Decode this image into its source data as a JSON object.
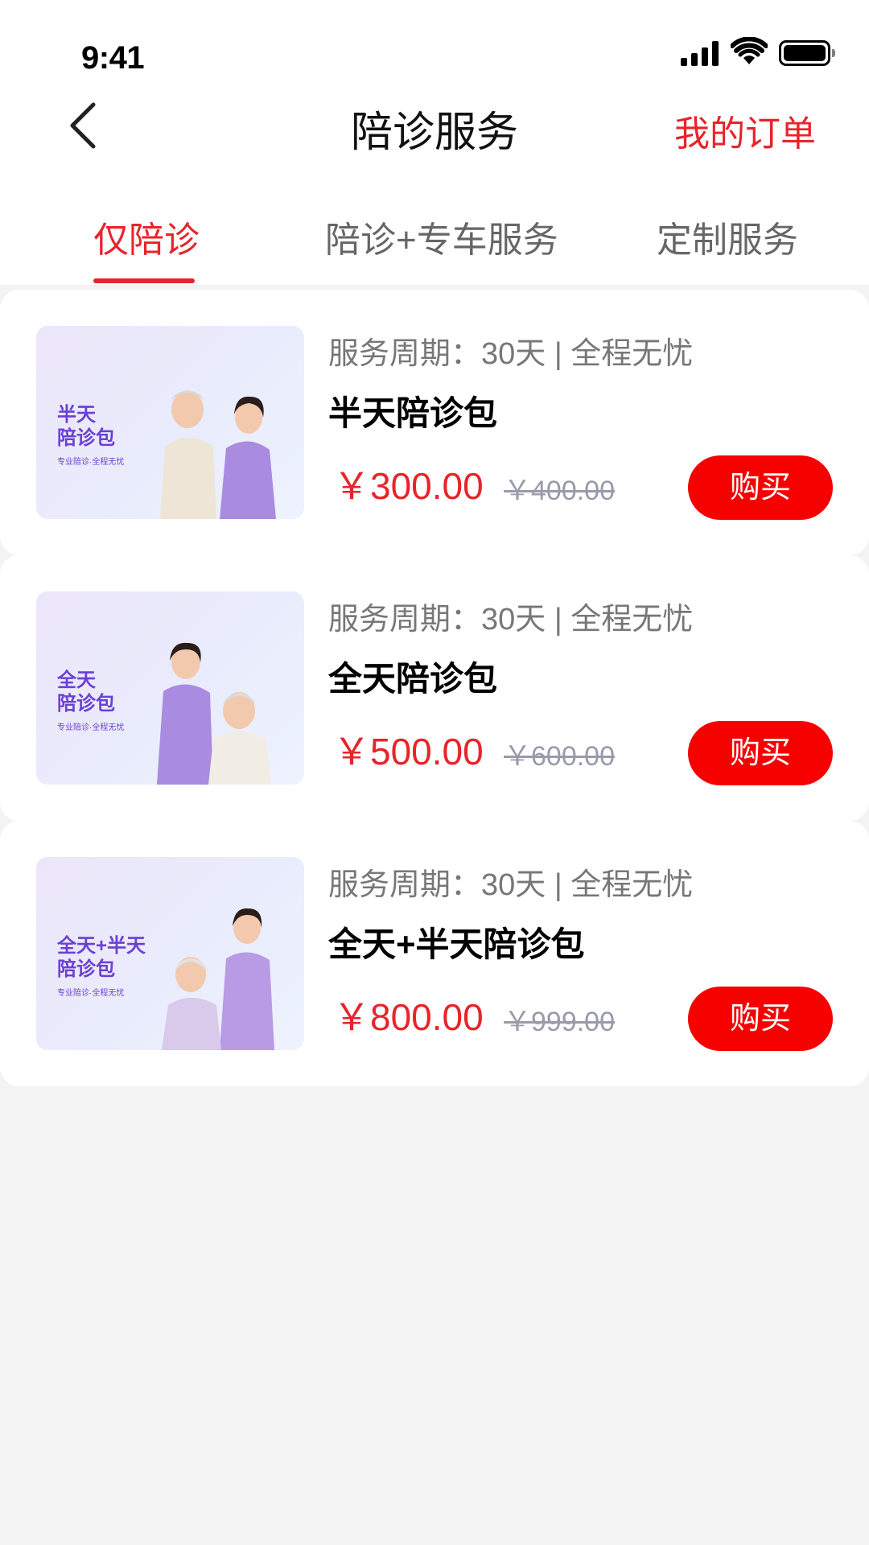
{
  "status_bar": {
    "time": "9:41"
  },
  "header": {
    "title": "陪诊服务",
    "orders_link": "我的订单"
  },
  "tabs": [
    {
      "label": "仅陪诊",
      "active": true
    },
    {
      "label": "陪诊+专车服务",
      "active": false
    },
    {
      "label": "定制服务",
      "active": false
    }
  ],
  "products": [
    {
      "image_title": "半天\n陪诊包",
      "image_subtitle": "专业陪诊·全程无忧",
      "period": "服务周期：30天 | 全程无忧",
      "name": "半天陪诊包",
      "price": "￥300.00",
      "original_price": "￥400.00",
      "buy_label": "购买"
    },
    {
      "image_title": "全天\n陪诊包",
      "image_subtitle": "专业陪诊·全程无忧",
      "period": "服务周期：30天 | 全程无忧",
      "name": "全天陪诊包",
      "price": "￥500.00",
      "original_price": "￥600.00",
      "buy_label": "购买"
    },
    {
      "image_title": "全天+半天\n陪诊包",
      "image_subtitle": "专业陪诊·全程无忧",
      "period": "服务周期：30天 | 全程无忧",
      "name": "全天+半天陪诊包",
      "price": "￥800.00",
      "original_price": "￥999.00",
      "buy_label": "购买"
    }
  ],
  "colors": {
    "accent": "#e8242a",
    "buy_button": "#f60000",
    "page_background": "#f3f3f3",
    "image_title": "#6b3fd4"
  }
}
